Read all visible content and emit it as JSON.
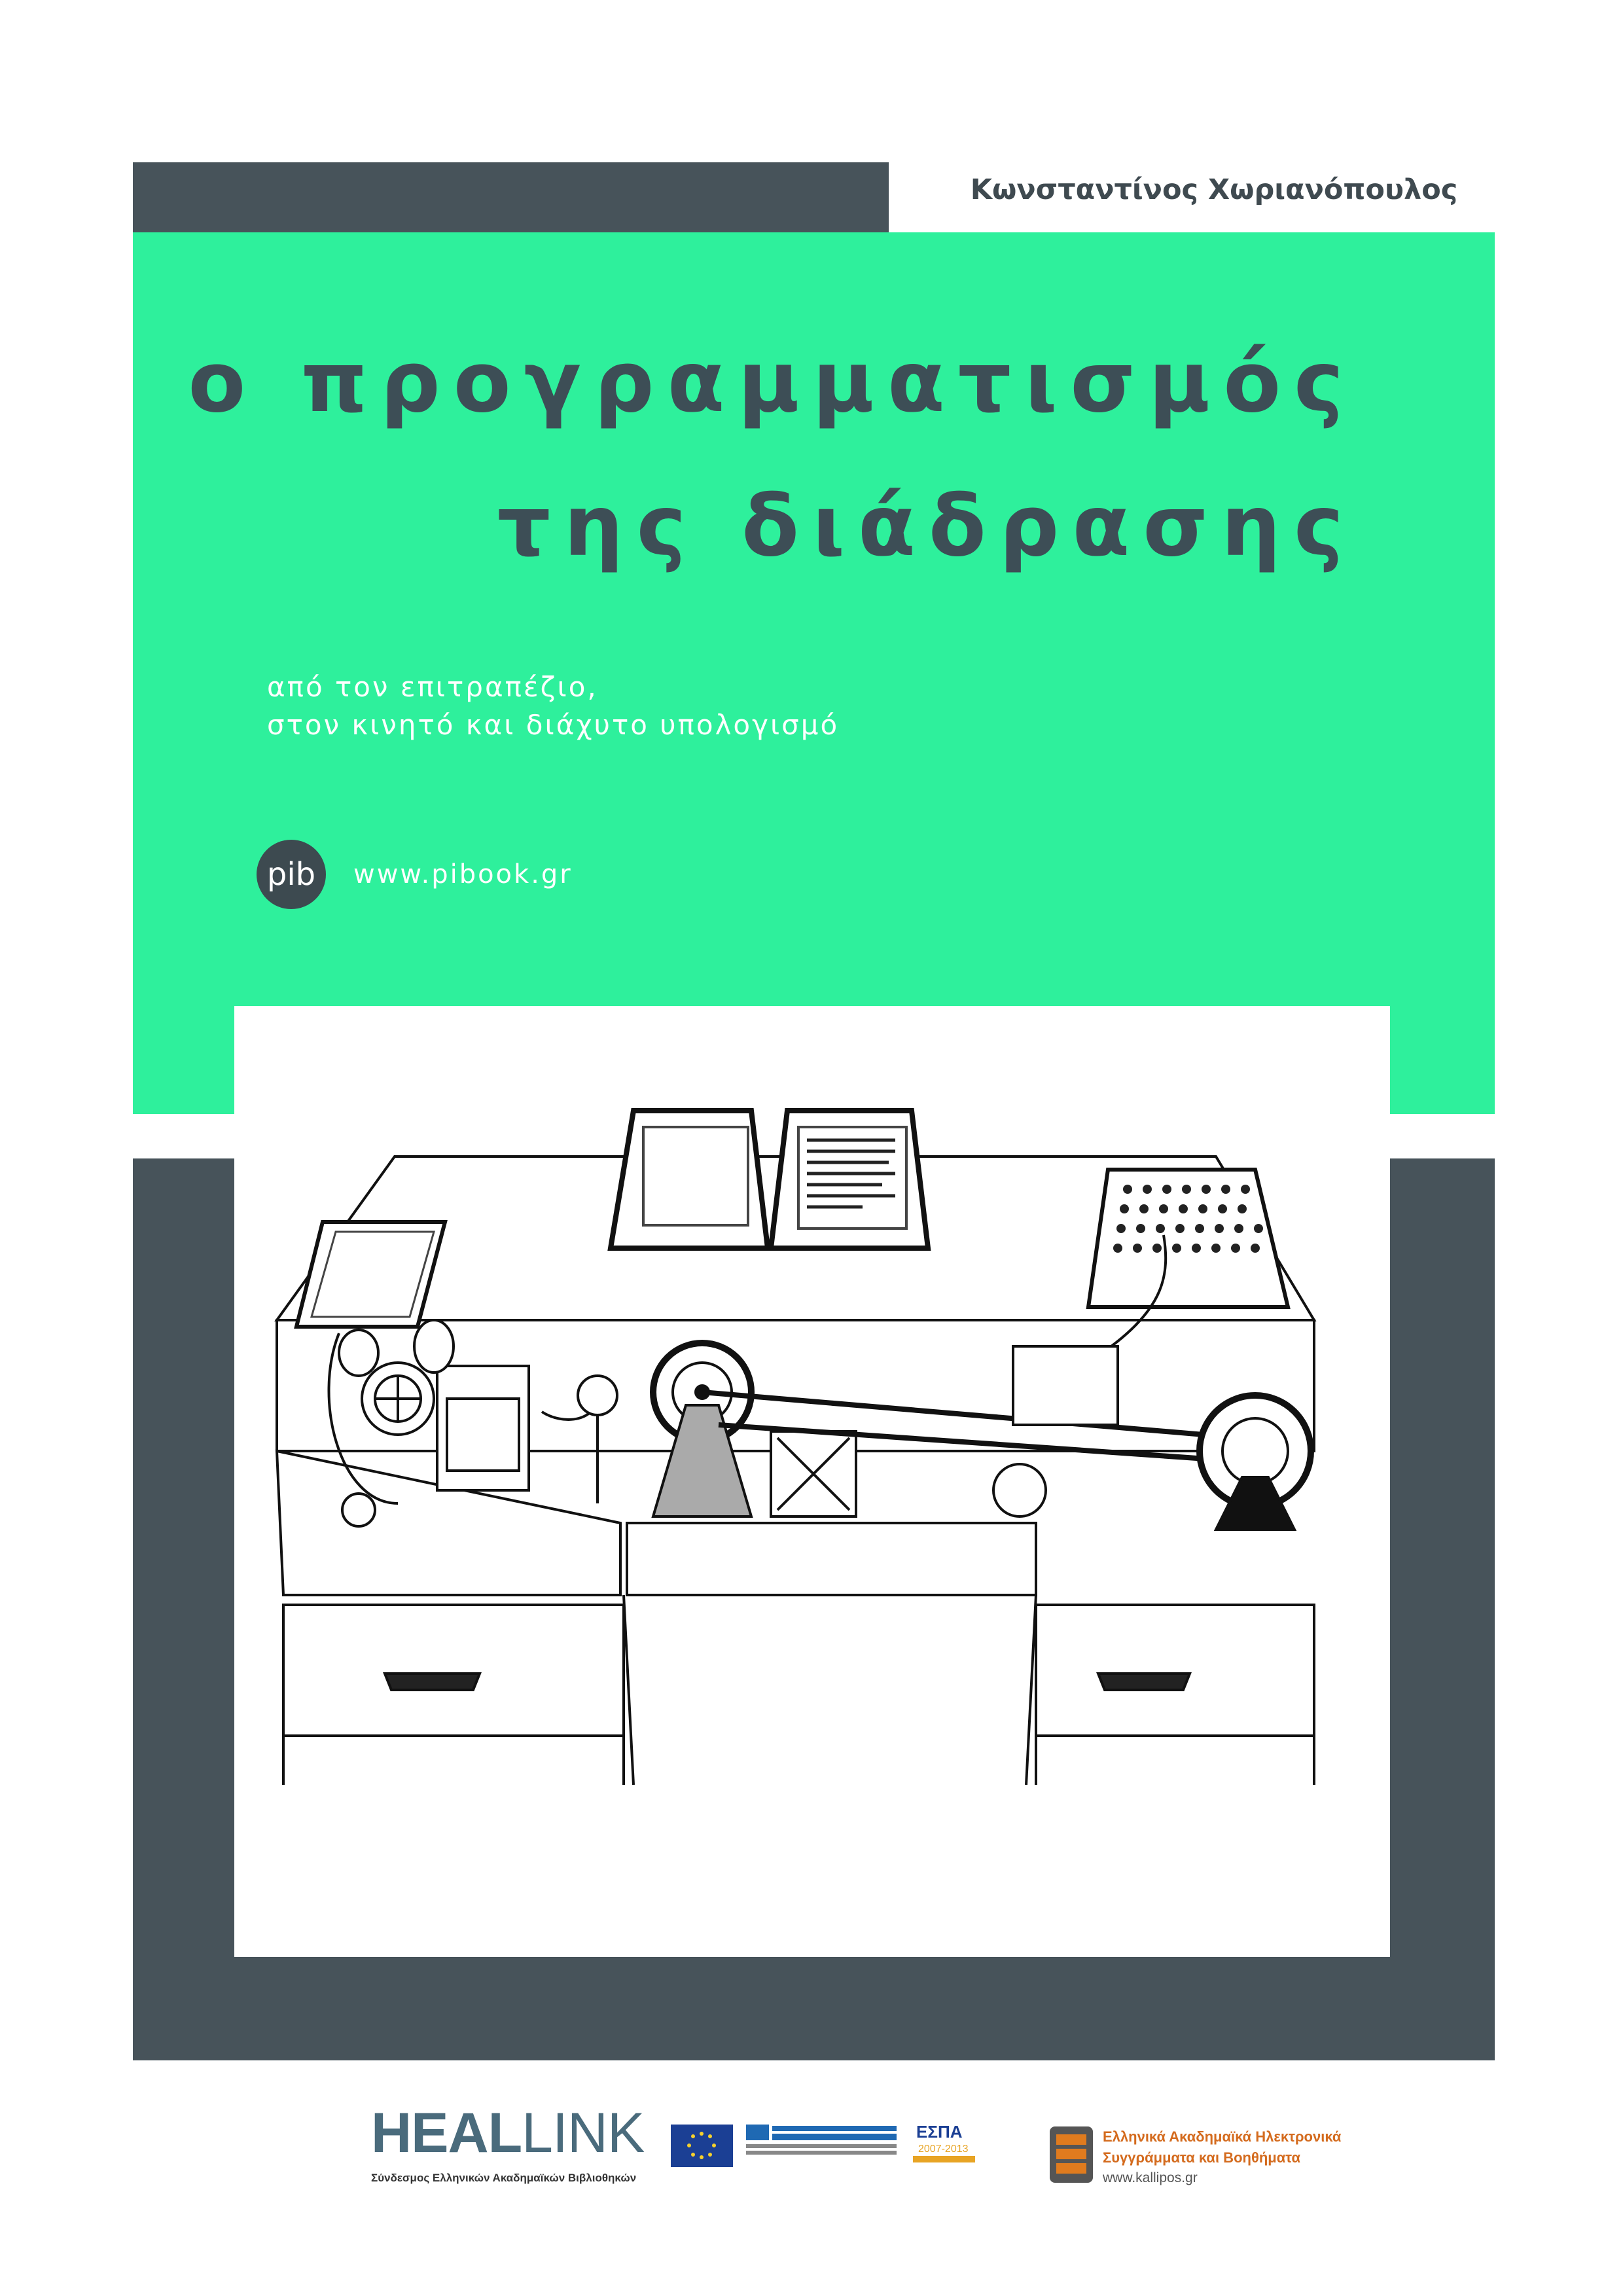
{
  "cover": {
    "author": "Κωνσταντίνος Χωριανόπουλος",
    "title_line1": "ο προγραμματισμός",
    "title_line2": "της διάδρασης",
    "subtitle_line1": "από τον επιτραπέζιο,",
    "subtitle_line2": "στον κινητό και διάχυτο υπολογισμό",
    "publisher_logo_text": "pib",
    "publisher_url": "www.pibook.gr"
  },
  "footer": {
    "heallink_bold": "HEAL",
    "heallink_light": "LINK",
    "heallink_sub": "Σύνδεσμος Ελληνικών Ακαδημαϊκών Βιβλιοθηκών",
    "kallipos_line1": "Ελληνικά Ακαδημαϊκά Ηλεκτρονικά",
    "kallipos_line2": "Συγγράμματα και Βοηθήματα",
    "kallipos_url": "www.kallipos.gr",
    "espa_text": "ΕΣΠΑ",
    "espa_years": "2007-2013"
  },
  "colors": {
    "green": "#2ef09c",
    "dark": "#47535a",
    "title": "#3d4e56",
    "kallipos_orange": "#d46b1e"
  }
}
